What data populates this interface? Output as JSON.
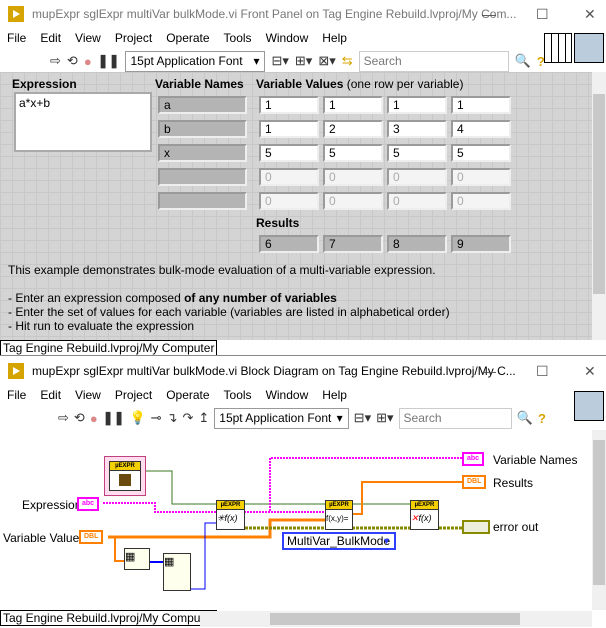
{
  "front_panel": {
    "title": "mupExpr sglExpr multiVar bulkMode.vi Front Panel on Tag Engine Rebuild.lvproj/My Com...",
    "menu": [
      "File",
      "Edit",
      "View",
      "Project",
      "Operate",
      "Tools",
      "Window",
      "Help"
    ],
    "font": "15pt Application Font",
    "search_placeholder": "Search",
    "expression_label": "Expression",
    "expression_value": "a*x+b",
    "variable_names_label": "Variable Names",
    "variable_names": [
      "a",
      "b",
      "x",
      "",
      ""
    ],
    "variable_values_label": "Variable Values",
    "variable_values_note": "(one row per variable)",
    "variable_values": [
      [
        "1",
        "1",
        "1",
        "1"
      ],
      [
        "1",
        "2",
        "3",
        "4"
      ],
      [
        "5",
        "5",
        "5",
        "5"
      ],
      [
        "0",
        "0",
        "0",
        "0"
      ],
      [
        "0",
        "0",
        "0",
        "0"
      ]
    ],
    "results_label": "Results",
    "results": [
      "6",
      "7",
      "8",
      "9"
    ],
    "description": {
      "line1": "This example demonstrates bulk-mode evaluation of a multi-variable expression.",
      "line2a": "- Enter an expression composed ",
      "line2b": "of any number of variables",
      "line3": "- Enter the set of values for each variable (variables are listed in alphabetical order)",
      "line4": "- Hit run to evaluate the expression"
    },
    "status": "Tag Engine Rebuild.lvproj/My Computer"
  },
  "block_diagram": {
    "title": "mupExpr sglExpr multiVar bulkMode.vi Block Diagram on Tag Engine Rebuild.lvproj/My C...",
    "menu": [
      "File",
      "Edit",
      "View",
      "Project",
      "Operate",
      "Tools",
      "Window",
      "Help"
    ],
    "font": "15pt Application Font",
    "search_placeholder": "Search",
    "labels": {
      "expression": "Expression",
      "variable_values": "Variable Values",
      "variable_names": "Variable Names",
      "results": "Results",
      "error_out": "error out"
    },
    "terminals": {
      "abc": "abc",
      "dbl": "DBL"
    },
    "node_header": "µEXPR",
    "enum_value": "MultiVar_BulkMode",
    "status": "Tag Engine Rebuild.lvproj/My Computer"
  },
  "colors": {
    "string_wire": "#ff00ff",
    "dbl_wire": "#ff8000",
    "error_wire": "#8a8a00",
    "class_wire": "#3a7a20",
    "int_wire": "#0000ff"
  }
}
